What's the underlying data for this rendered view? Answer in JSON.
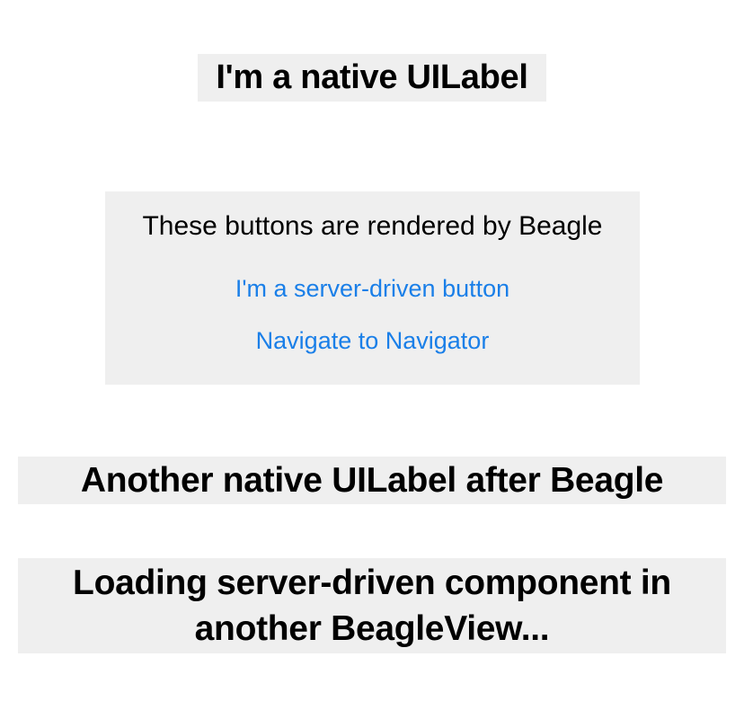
{
  "native_label": {
    "text": "I'm a native UILabel"
  },
  "beagle_view": {
    "caption": "These buttons are rendered by Beagle",
    "buttons": [
      {
        "label": "I'm a server-driven button"
      },
      {
        "label": "Navigate to Navigator"
      }
    ],
    "link_color": "#1a7fe8",
    "background_color": "#efefef"
  },
  "after_label": {
    "text": "Another native UILabel after Beagle"
  },
  "loading_label": {
    "line1": "Loading server-driven component in",
    "line2": "another BeagleView..."
  }
}
